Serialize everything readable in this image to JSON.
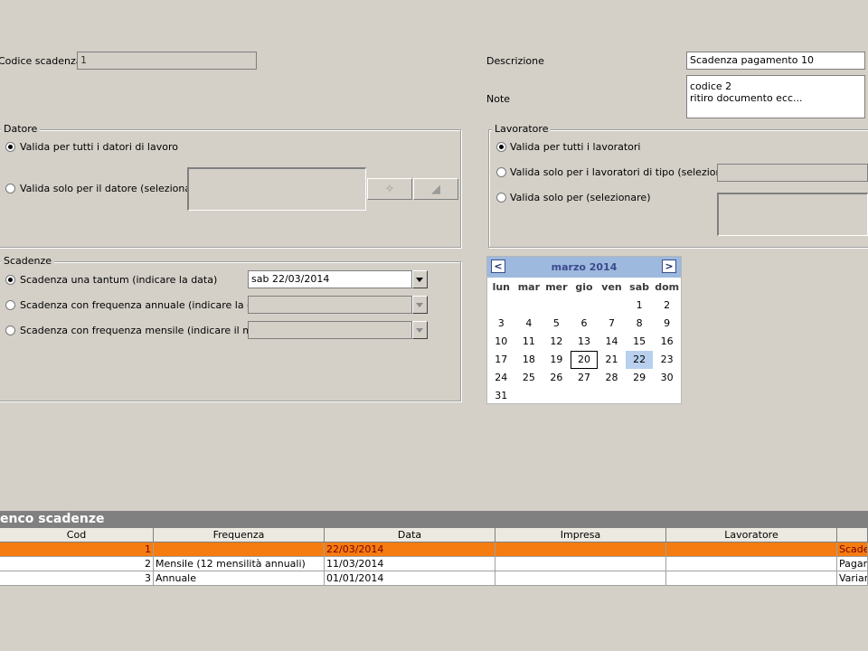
{
  "form": {
    "codice_label": "Codice scadenza",
    "codice_value": "1",
    "descrizione_label": "Descrizione",
    "descrizione_value": "Scadenza pagamento 10",
    "note_label": "Note",
    "note_value": "codice 2\nritiro documento ecc..."
  },
  "datore": {
    "title": "Datore",
    "option_all": "Valida per tutti i datori di lavoro",
    "option_one": "Valida solo per il datore (selezionare)",
    "selected": "all"
  },
  "lavoratore": {
    "title": "Lavoratore",
    "option_all": "Valida per tutti i lavoratori",
    "option_type": "Valida solo per i lavoratori di tipo (selezionare)",
    "option_one": "Valida solo per (selezionare)",
    "selected": "all"
  },
  "scadenze": {
    "title": "Scadenze",
    "option_tantum": "Scadenza una tantum (indicare la data)",
    "option_annuale": "Scadenza con frequenza annuale (indicare la data)",
    "option_mensile": "Scadenza con frequenza mensile (indicare il mese)",
    "tantum_value": "sab 22/03/2014",
    "selected": "tantum"
  },
  "calendar": {
    "title": "marzo 2014",
    "prev": "<",
    "next": ">",
    "weekdays": [
      "lun",
      "mar",
      "mer",
      "gio",
      "ven",
      "sab",
      "dom"
    ],
    "weeks": [
      [
        "",
        "",
        "",
        "",
        "",
        "1",
        "2"
      ],
      [
        "3",
        "4",
        "5",
        "6",
        "7",
        "8",
        "9"
      ],
      [
        "10",
        "11",
        "12",
        "13",
        "14",
        "15",
        "16"
      ],
      [
        "17",
        "18",
        "19",
        "20",
        "21",
        "22",
        "23"
      ],
      [
        "24",
        "25",
        "26",
        "27",
        "28",
        "29",
        "30"
      ],
      [
        "31",
        "",
        "",
        "",
        "",
        "",
        ""
      ]
    ],
    "today": "20",
    "selected": "22"
  },
  "list": {
    "title": "enco scadenze",
    "columns": [
      "Cod",
      "Frequenza",
      "Data",
      "Impresa",
      "Lavoratore",
      ""
    ],
    "rows": [
      {
        "cod": "1",
        "frequenza": "",
        "data": "22/03/2014",
        "impresa": "",
        "lavoratore": "",
        "descrizione": "Scaden",
        "selected": true
      },
      {
        "cod": "2",
        "frequenza": "Mensile (12 mensilità annuali)",
        "data": "11/03/2014",
        "impresa": "",
        "lavoratore": "",
        "descrizione": "Pagamo",
        "selected": false
      },
      {
        "cod": "3",
        "frequenza": "Annuale",
        "data": "01/01/2014",
        "impresa": "",
        "lavoratore": "",
        "descrizione": "Variare",
        "selected": false
      }
    ]
  },
  "colors": {
    "background": "#d4d0c8",
    "selected_row": "#f57c10",
    "calendar_header": "#9db9de",
    "calendar_selected": "#b8d0ee"
  }
}
